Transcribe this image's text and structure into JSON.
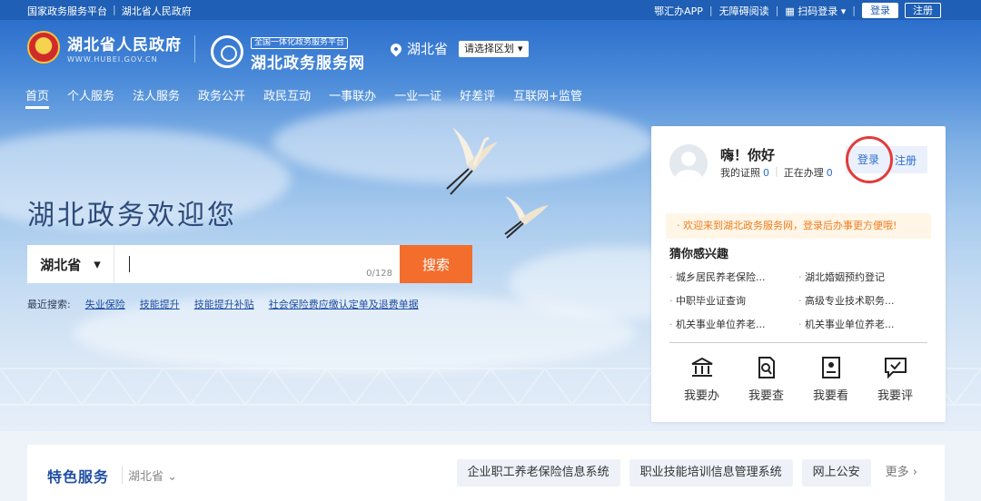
{
  "topbar": {
    "left_links": [
      "国家政务服务平台",
      "湖北省人民政府"
    ],
    "right_links": [
      "鄂汇办APP",
      "无障碍阅读",
      "扫码登录"
    ],
    "login_label": "登录",
    "register_label": "注册"
  },
  "header": {
    "gov_title": "湖北省人民政府",
    "gov_sub": "WWW.HUBEI.GOV.CN",
    "svc_tag": "全国一体化政务服务平台",
    "svc_title": "湖北政务服务网",
    "region": "湖北省",
    "region_select": "请选择区划"
  },
  "nav": {
    "items": [
      "首页",
      "个人服务",
      "法人服务",
      "政务公开",
      "政民互动",
      "一事联办",
      "一业一证",
      "好差评",
      "互联网+监管"
    ],
    "active": "首页"
  },
  "hero": {
    "welcome": "湖北政务欢迎您",
    "search": {
      "province": "湖北省",
      "counter": "0/128",
      "button": "搜索"
    },
    "recent_label": "最近搜索:",
    "recent": [
      "失业保险",
      "技能提升",
      "技能提升补贴",
      "社会保险费应缴认定单及退费单据"
    ]
  },
  "panel": {
    "greet": "嗨！你好",
    "cert_label": "我的证照",
    "cert_count": "0",
    "doing_label": "正在办理",
    "doing_count": "0",
    "login": "登录",
    "register": "注册",
    "notice": "· 欢迎来到湖北政务服务网，登录后办事更方便哦!",
    "interest_title": "猜你感兴趣",
    "interest": [
      "城乡居民养老保险...",
      "湖北婚姻预约登记",
      "中职毕业证查询",
      "高级专业技术职务...",
      "机关事业单位养老...",
      "机关事业单位养老..."
    ],
    "actions": [
      {
        "label": "我要办",
        "icon": "bank-icon"
      },
      {
        "label": "我要查",
        "icon": "document-search-icon"
      },
      {
        "label": "我要看",
        "icon": "id-card-icon"
      },
      {
        "label": "我要评",
        "icon": "chat-check-icon"
      }
    ]
  },
  "band": {
    "title": "特色服务",
    "region": "湖北省",
    "buttons": [
      "企业职工养老保险信息系统",
      "职业技能培训信息管理系统",
      "网上公安"
    ],
    "more": "更多"
  },
  "colors": {
    "topbar": "#1f5fb5",
    "search_button": "#f36d2c",
    "highlight_ring": "#e33b3b",
    "link": "#2f6cd1",
    "notice_text": "#f07c1b"
  }
}
